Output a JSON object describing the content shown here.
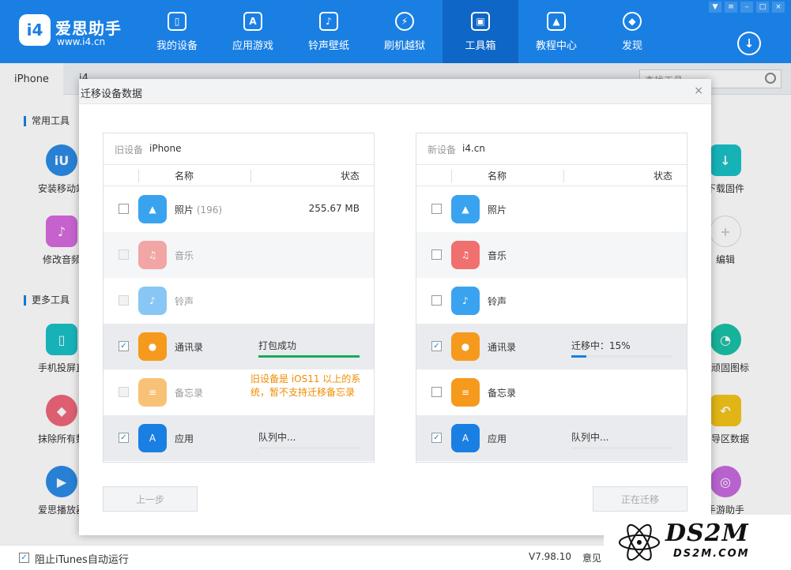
{
  "app": {
    "brand": "爱思助手",
    "url": "www.i4.cn",
    "logo_text": "i4"
  },
  "nav": [
    {
      "label": "我的设备",
      "icon": "phone-icon",
      "glyph": "▯"
    },
    {
      "label": "应用游戏",
      "icon": "app-store-icon",
      "glyph": "A"
    },
    {
      "label": "铃声壁纸",
      "icon": "music-wallpaper-icon",
      "glyph": "♪"
    },
    {
      "label": "刷机越狱",
      "icon": "flash-icon",
      "glyph": "⚡"
    },
    {
      "label": "工具箱",
      "icon": "toolbox-icon",
      "glyph": "▣"
    },
    {
      "label": "教程中心",
      "icon": "graduation-icon",
      "glyph": "▲"
    },
    {
      "label": "发现",
      "icon": "compass-icon",
      "glyph": "◆"
    }
  ],
  "tabs": {
    "device_tab": "iPhone",
    "second_tab": "i4",
    "search_placeholder": "查找工具"
  },
  "sections": {
    "common": "常用工具",
    "more": "更多工具"
  },
  "tools_left": [
    {
      "label": "安装移动端",
      "icon": "i4-app-icon",
      "color": "#2b8be6"
    },
    {
      "label": "修改音频",
      "icon": "audio-edit-icon",
      "color": "#d66be0"
    },
    {
      "label": "手机投屏直",
      "icon": "screen-mirror-icon",
      "color": "#19c2c8"
    },
    {
      "label": "抹除所有数",
      "icon": "eraser-icon",
      "color": "#f0677a"
    },
    {
      "label": "爱思播放器",
      "icon": "player-icon",
      "color": "#2b8be6"
    }
  ],
  "tools_right": [
    {
      "label": "下载固件",
      "icon": "firmware-download-icon",
      "color": "#19c2c8"
    },
    {
      "label": "编辑",
      "icon": "plus-icon",
      "color": "#ffffff"
    },
    {
      "label": "除顽固图标",
      "icon": "pie-icon",
      "color": "#19c2a8"
    },
    {
      "label": "引导区数据",
      "icon": "folder-back-icon",
      "color": "#f5c518"
    },
    {
      "label": "手游助手",
      "icon": "game-helper-icon",
      "color": "#c86be0"
    }
  ],
  "modal": {
    "title": "迁移设备数据",
    "close": "×",
    "old_device_prefix": "旧设备",
    "old_device_name": "iPhone",
    "new_device_prefix": "新设备",
    "new_device_name": "i4.cn",
    "col_name": "名称",
    "col_status": "状态",
    "prev_button": "上一步",
    "migrating_button": "正在迁移"
  },
  "old_items": [
    {
      "name": "照片",
      "count": "(196)",
      "size": "255.67 MB",
      "status": "",
      "checked": false,
      "disabled": false,
      "icon": "photos-icon",
      "color": "#3aa3f0",
      "glyph": "▲",
      "progress": null
    },
    {
      "name": "音乐",
      "count": "",
      "size": "",
      "status": "",
      "checked": false,
      "disabled": true,
      "icon": "music-icon",
      "color": "#f07070",
      "glyph": "♫",
      "progress": null
    },
    {
      "name": "铃声",
      "count": "",
      "size": "",
      "status": "",
      "checked": false,
      "disabled": true,
      "icon": "bell-icon",
      "color": "#3aa3f0",
      "glyph": "♪",
      "progress": null
    },
    {
      "name": "通讯录",
      "count": "",
      "size": "",
      "status": "打包成功",
      "checked": true,
      "disabled": false,
      "icon": "contacts-icon",
      "color": "#f59a1c",
      "glyph": "●",
      "progress": 1.0,
      "bar_color": "#1aaa5a"
    },
    {
      "name": "备忘录",
      "count": "",
      "size": "",
      "status": "",
      "checked": false,
      "disabled": true,
      "icon": "notes-icon",
      "color": "#f59a1c",
      "glyph": "≡",
      "progress": null,
      "warning": "旧设备是 iOS11 以上的系统，暂不支持迁移备忘录"
    },
    {
      "name": "应用",
      "count": "",
      "size": "",
      "status": "队列中...",
      "checked": true,
      "disabled": false,
      "icon": "app-store-icon",
      "color": "#1a7fe3",
      "glyph": "A",
      "progress": 0.0,
      "bar_color": "#1a7fe3"
    }
  ],
  "new_items": [
    {
      "name": "照片",
      "status": "",
      "checked": false,
      "icon": "photos-icon",
      "color": "#3aa3f0",
      "glyph": "▲",
      "progress": null
    },
    {
      "name": "音乐",
      "status": "",
      "checked": false,
      "icon": "music-icon",
      "color": "#f07070",
      "glyph": "♫",
      "progress": null
    },
    {
      "name": "铃声",
      "status": "",
      "checked": false,
      "icon": "bell-icon",
      "color": "#3aa3f0",
      "glyph": "♪",
      "progress": null
    },
    {
      "name": "通讯录",
      "status": "迁移中：15%",
      "checked": true,
      "icon": "contacts-icon",
      "color": "#f59a1c",
      "glyph": "●",
      "progress": 0.15,
      "bar_color": "#1a7fe3"
    },
    {
      "name": "备忘录",
      "status": "",
      "checked": false,
      "icon": "notes-icon",
      "color": "#f59a1c",
      "glyph": "≡",
      "progress": null
    },
    {
      "name": "应用",
      "status": "队列中...",
      "checked": true,
      "icon": "app-store-icon",
      "color": "#1a7fe3",
      "glyph": "A",
      "progress": 0.0,
      "bar_color": "#1a7fe3"
    }
  ],
  "footer": {
    "block_itunes": "阻止iTunes自动运行",
    "version": "V7.98.10",
    "feedback": "意见"
  },
  "watermark": {
    "text": "DS2M",
    "sub": "DS2M.COM"
  }
}
